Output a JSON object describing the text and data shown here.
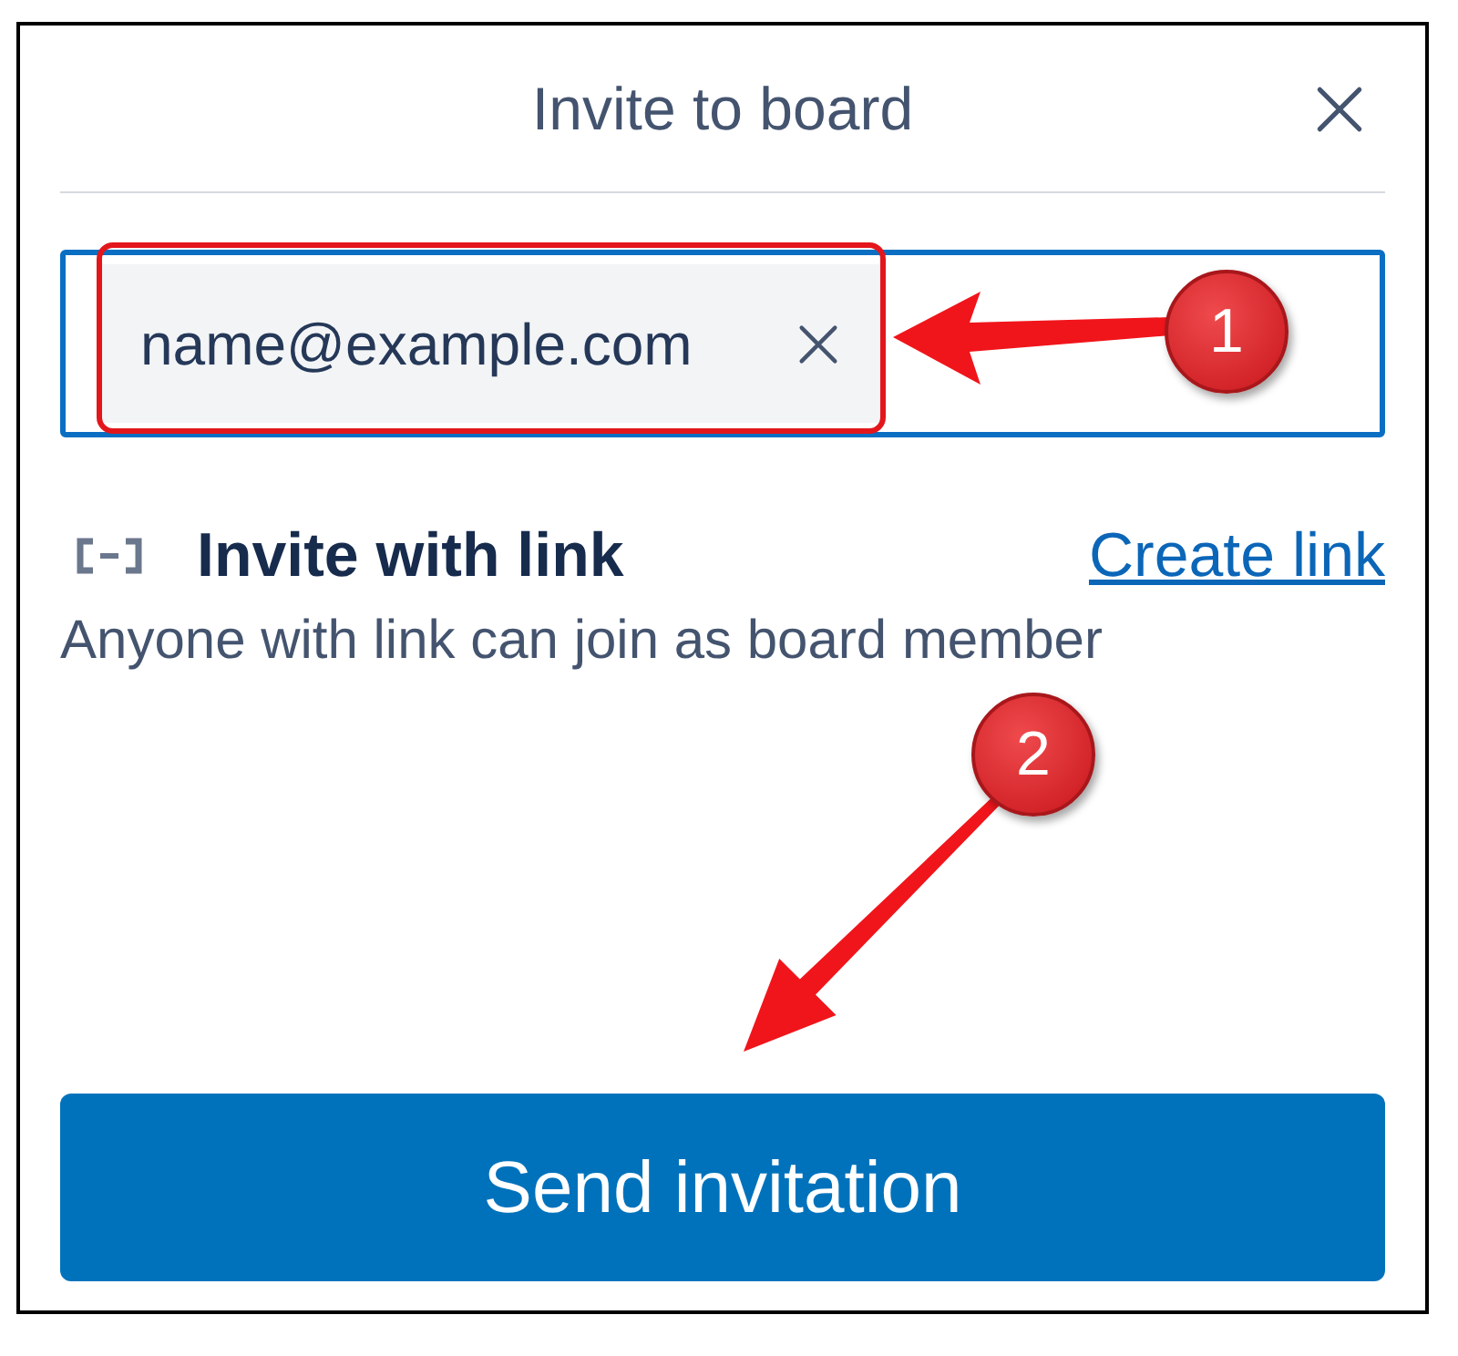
{
  "dialog": {
    "title": "Invite to board"
  },
  "invite_field": {
    "chips": [
      {
        "value": "name@example.com"
      }
    ]
  },
  "invite_link": {
    "title": "Invite with link",
    "action": "Create link",
    "description": "Anyone with link can join as board member"
  },
  "primary_button": {
    "label": "Send invitation"
  },
  "annotations": [
    {
      "label": "1"
    },
    {
      "label": "2"
    }
  ]
}
